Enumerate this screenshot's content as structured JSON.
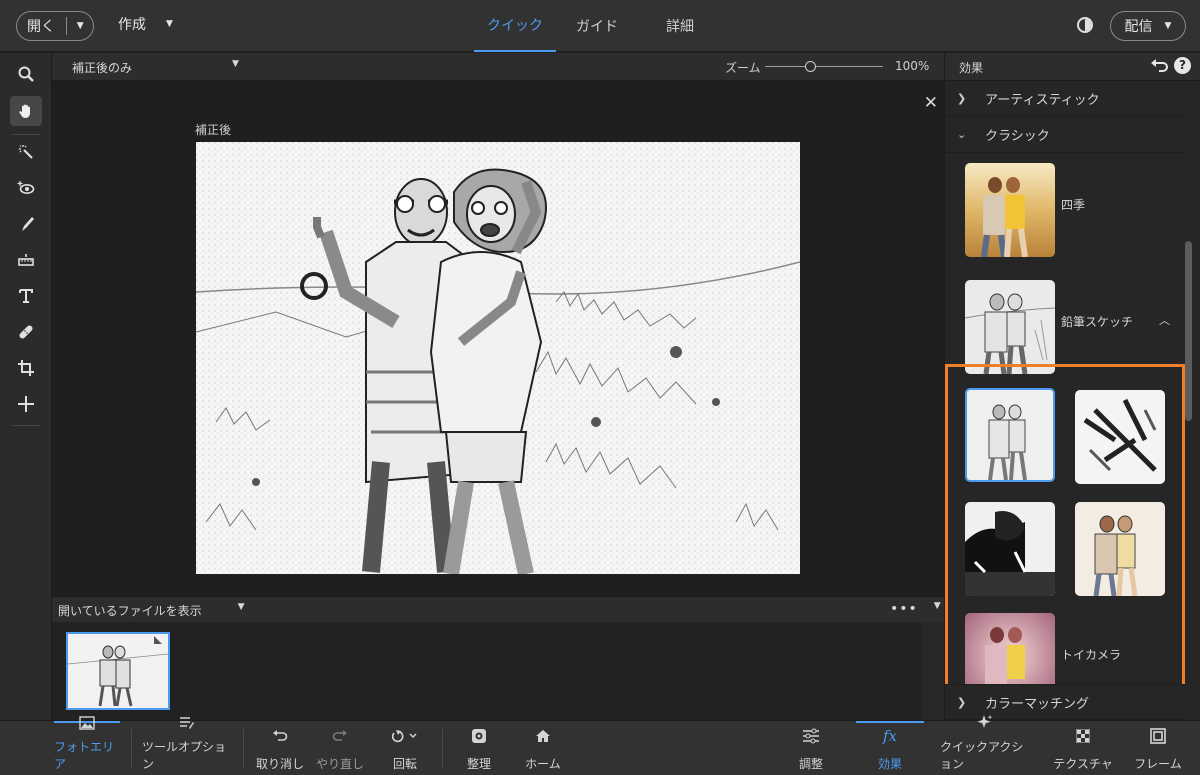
{
  "topbar": {
    "open_label": "開く",
    "create_label": "作成",
    "modes": [
      "クイック",
      "ガイド",
      "詳細"
    ],
    "active_mode": "クイック",
    "share_label": "配信"
  },
  "canvas": {
    "view_option": "補正後のみ",
    "zoom_label": "ズーム",
    "zoom_value": "100%",
    "photo_caption": "補正後"
  },
  "photo_bin": {
    "title": "開いているファイルを表示",
    "more": "•••"
  },
  "effects_panel": {
    "title": "効果",
    "categories": [
      {
        "label": "アーティスティック",
        "expanded": false
      },
      {
        "label": "クラシック",
        "expanded": true
      },
      {
        "label": "カラーマッチング",
        "expanded": false
      }
    ],
    "effects": [
      "四季",
      "鉛筆スケッチ",
      "トイカメラ"
    ],
    "highlight_color": "#f07f2a",
    "selected_variant": 1
  },
  "bottombar": {
    "items": [
      "フォトエリア",
      "ツールオプション",
      "取り消し",
      "やり直し",
      "回転",
      "整理",
      "ホーム",
      "調整",
      "効果",
      "クイックアクション",
      "テクスチャ",
      "フレーム"
    ],
    "active": [
      "フォトエリア",
      "効果"
    ]
  },
  "colors": {
    "accent": "#4d9bf0",
    "highlight": "#f07f2a"
  }
}
